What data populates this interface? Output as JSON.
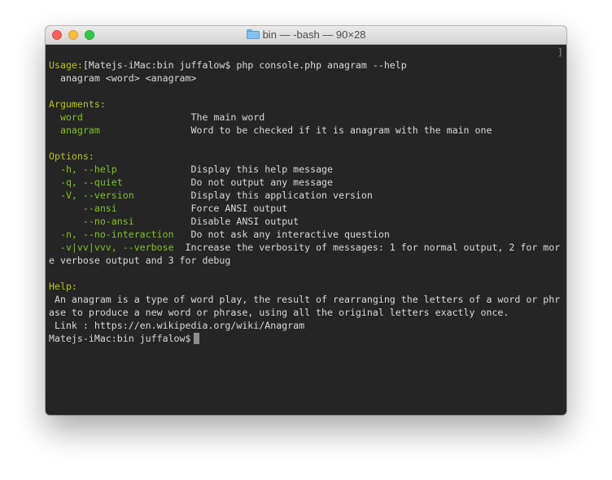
{
  "window": {
    "title": "bin — -bash — 90×28",
    "folder_icon": "folder-icon",
    "buttons": [
      "close",
      "minimize",
      "zoom"
    ]
  },
  "terminal": {
    "command_prompt": "[Matejs-iMac:bin juffalow$ php console.php anagram --help",
    "right_bracket": "]",
    "usage_header": "Usage:",
    "usage_line": "  anagram <word> <anagram>",
    "arguments_header": "Arguments:",
    "arguments": [
      {
        "name": "  word",
        "pad": "                   ",
        "desc": "The main word"
      },
      {
        "name": "  anagram",
        "pad": "                ",
        "desc": "Word to be checked if it is anagram with the main one"
      }
    ],
    "options_header": "Options:",
    "options": [
      {
        "name": "  -h, --help",
        "pad": "             ",
        "desc": "Display this help message"
      },
      {
        "name": "  -q, --quiet",
        "pad": "            ",
        "desc": "Do not output any message"
      },
      {
        "name": "  -V, --version",
        "pad": "          ",
        "desc": "Display this application version"
      },
      {
        "name": "      --ansi",
        "pad": "             ",
        "desc": "Force ANSI output"
      },
      {
        "name": "      --no-ansi",
        "pad": "          ",
        "desc": "Disable ANSI output"
      },
      {
        "name": "  -n, --no-interaction",
        "pad": "   ",
        "desc": "Do not ask any interactive question"
      },
      {
        "name": "  -v|vv|vvv, --verbose",
        "pad": "  ",
        "desc": "Increase the verbosity of messages: 1 for normal output, 2 for mor"
      }
    ],
    "verbose_wrap": "e verbose output and 3 for debug",
    "help_header": "Help:",
    "help_lines": [
      " An anagram is a type of word play, the result of rearranging the letters of a word or phr",
      "ase to produce a new word or phrase, using all the original letters exactly once.",
      " Link : https://en.wikipedia.org/wiki/Anagram"
    ],
    "final_prompt": "Matejs-iMac:bin juffalow$"
  }
}
